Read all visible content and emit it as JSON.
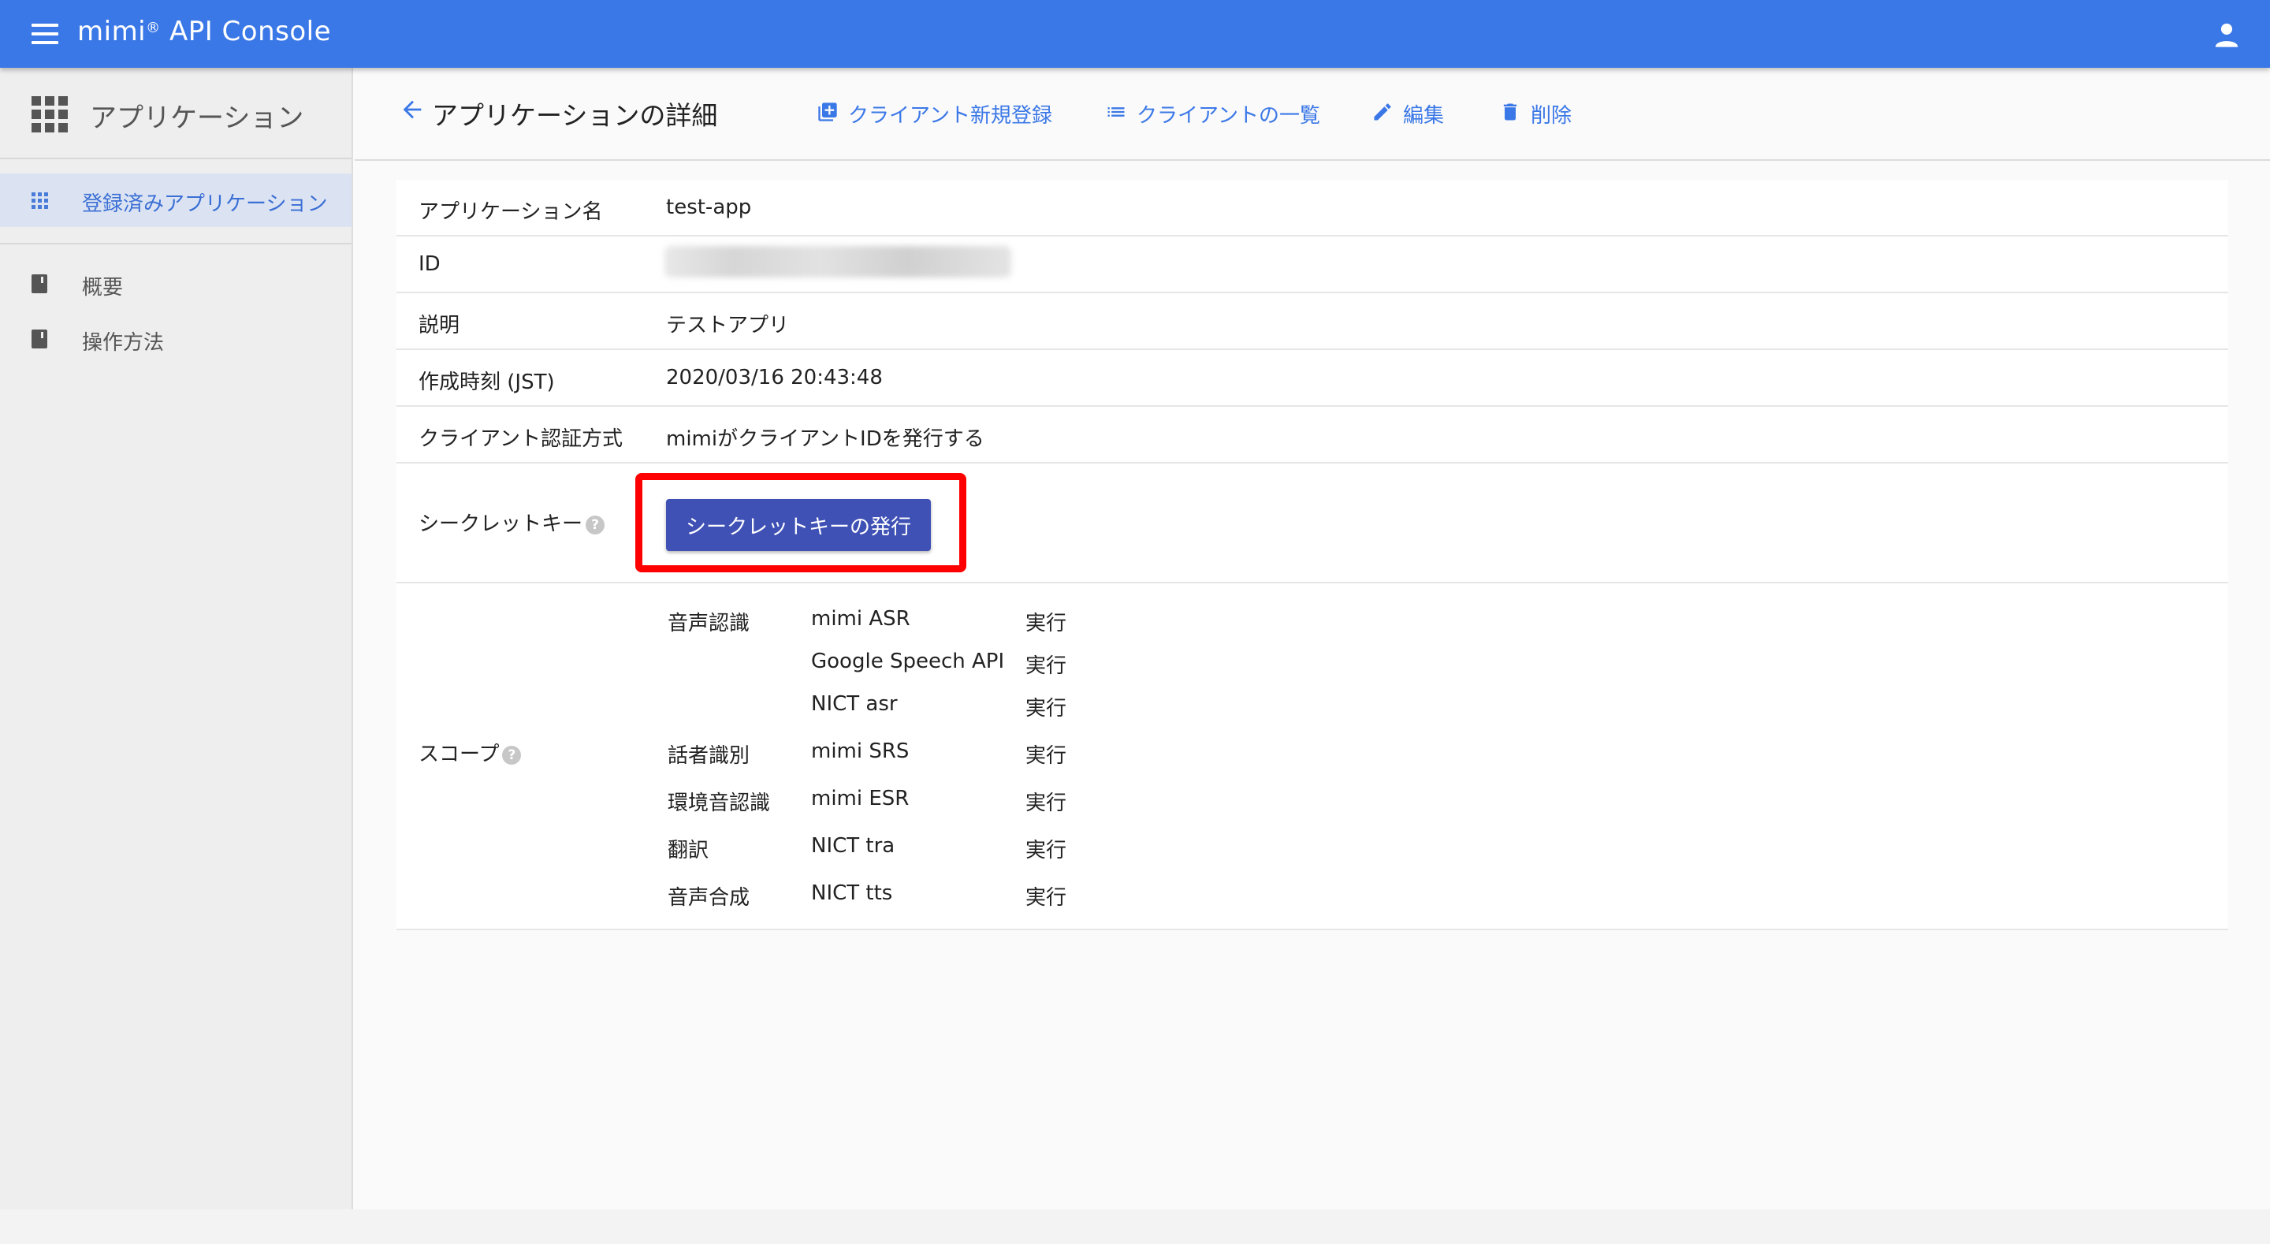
{
  "topbar": {
    "title": "mimi",
    "title_mark": "®",
    "title_rest": " API Console"
  },
  "sidebar": {
    "title": "アプリケーション",
    "active_item": "登録済みアプリケーション",
    "links": [
      "概要",
      "操作方法"
    ]
  },
  "header": {
    "title": "アプリケーションの詳細",
    "actions": [
      "クライアント新規登録",
      "クライアントの一覧",
      "編集",
      "削除"
    ]
  },
  "details": {
    "app_name_label": "アプリケーション名",
    "app_name": "test-app",
    "id_label": "ID",
    "description_label": "説明",
    "description": "テストアプリ",
    "created_label": "作成時刻 (JST)",
    "created": "2020/03/16 20:43:48",
    "auth_label": "クライアント認証方式",
    "auth": "mimiがクライアントIDを発行する",
    "secret_label": "シークレットキー",
    "secret_button": "シークレットキーの発行",
    "scope_label": "スコープ",
    "help_glyph": "?"
  },
  "scopes": [
    {
      "category": "音声認識",
      "service": "mimi ASR",
      "permission": "実行"
    },
    {
      "category": "",
      "service": "Google Speech API",
      "permission": "実行"
    },
    {
      "category": "",
      "service": "NICT asr",
      "permission": "実行"
    },
    {
      "category": "話者識別",
      "service": "mimi SRS",
      "permission": "実行"
    },
    {
      "category": "環境音認識",
      "service": "mimi ESR",
      "permission": "実行"
    },
    {
      "category": "翻訳",
      "service": "NICT tra",
      "permission": "実行"
    },
    {
      "category": "音声合成",
      "service": "NICT tts",
      "permission": "実行"
    }
  ],
  "colors": {
    "accent": "#3b78e7",
    "button": "#3f51b5",
    "highlight": "#ff0000"
  }
}
